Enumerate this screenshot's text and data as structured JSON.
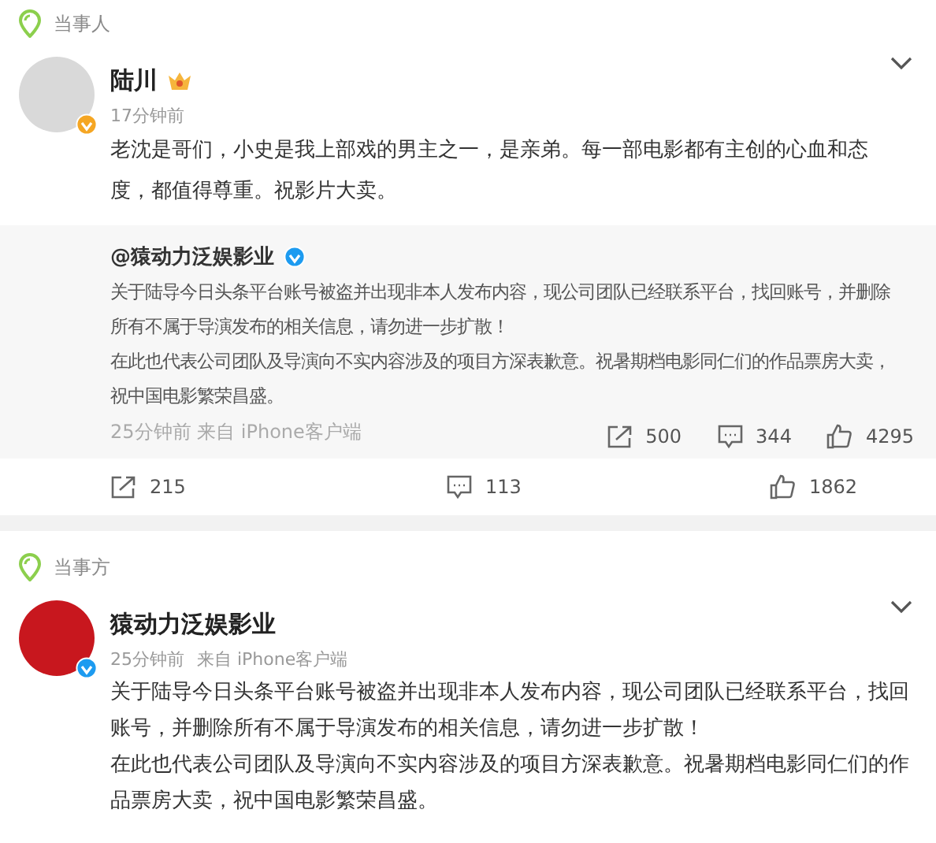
{
  "sections": [
    {
      "label": "当事人",
      "post": {
        "name": "陆川",
        "verified": true,
        "color": "#f5a623",
        "crown": true,
        "meta": [
          "17分钟前"
        ],
        "paragraphs": [
          "老沈是哥们，小史是我上部戏的男主之一，是亲弟。每一部电影都有主创的心血和态度，都值得尊重。祝影片大卖。"
        ],
        "repost": {
          "author": "@猿动力泛娱影业",
          "paragraphs": [
            "关于陆导今日头条平台账号被盗并出现非本人发布内容，现公司团队已经联系平台，找回账号，并删除所有不属于导演发布的相关信息，请勿进一步扩散！",
            "在此也代表公司团队及导演向不实内容涉及的项目方深表歉意。祝暑期档电影同仁们的作品票房大卖，祝中国电影繁荣昌盛。"
          ],
          "meta": "25分钟前 来自 iPhone客户端",
          "shares": "500",
          "comments": "344",
          "likes": "4295"
        },
        "actions": {
          "shares": "215",
          "comments": "113",
          "likes": "1862"
        }
      }
    },
    {
      "label": "当事方",
      "post": {
        "name": "猿动力泛娱影业",
        "verified": true,
        "color": "#1d9bf0",
        "meta": [
          "25分钟前",
          "来自 iPhone客户端"
        ],
        "paragraphs": [
          "关于陆导今日头条平台账号被盗并出现非本人发布内容，现公司团队已经联系平台，找回账号，并删除所有不属于导演发布的相关信息，请勿进一步扩散！",
          "在此也代表公司团队及导演向不实内容涉及的项目方深表歉意。祝暑期档电影同仁们的作品票房大卖，祝中国电影繁荣昌盛。"
        ]
      }
    }
  ]
}
